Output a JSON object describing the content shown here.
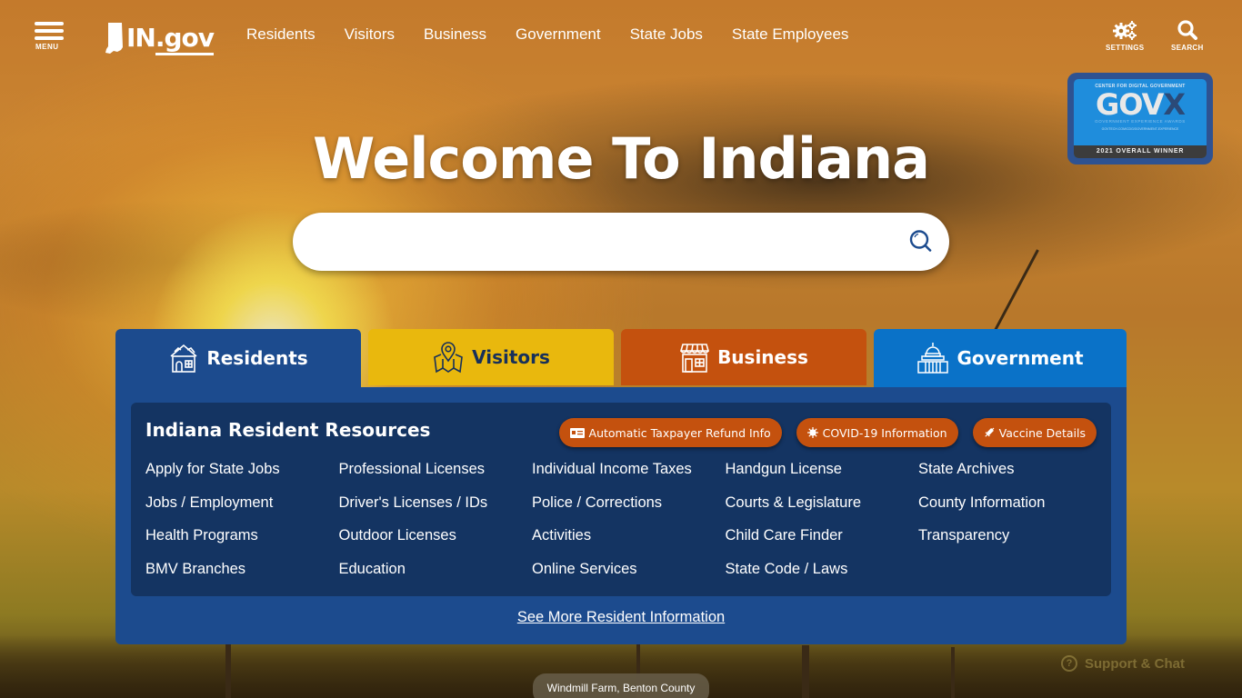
{
  "header": {
    "menu_label": "MENU",
    "logo_text": "IN",
    "logo_suffix": ".gov",
    "nav": [
      "Residents",
      "Visitors",
      "Business",
      "Government",
      "State Jobs",
      "State Employees"
    ],
    "settings_label": "SETTINGS",
    "search_label": "SEARCH"
  },
  "award": {
    "org": "CENTER FOR DIGITAL GOVERNMENT",
    "brand_main": "GOV",
    "brand_x": "X",
    "program": "GOVERNMENT EXPERIENCE AWARDS",
    "url": "GOVTECH.COM/CDG/GOVERNMENT-EXPERIENCE",
    "winner": "2021 OVERALL WINNER"
  },
  "hero": {
    "title": "Welcome To Indiana",
    "search_value": "",
    "search_placeholder": ""
  },
  "tabs": [
    {
      "label": "Residents",
      "icon": "house-icon",
      "color": "#1c4b8e",
      "active": true
    },
    {
      "label": "Visitors",
      "icon": "map-pin-icon",
      "color": "#e9b80d",
      "active": false
    },
    {
      "label": "Business",
      "icon": "storefront-icon",
      "color": "#c4510e",
      "active": false
    },
    {
      "label": "Government",
      "icon": "capitol-icon",
      "color": "#0a72c8",
      "active": false
    }
  ],
  "panel": {
    "heading": "Indiana Resident Resources",
    "pills": [
      {
        "label": "Automatic Taxpayer Refund Info",
        "icon": "id-card-icon"
      },
      {
        "label": "COVID-19 Information",
        "icon": "virus-icon"
      },
      {
        "label": "Vaccine Details",
        "icon": "syringe-icon"
      }
    ],
    "links": [
      [
        "Apply for State Jobs",
        "Jobs / Employment",
        "Health Programs",
        "BMV Branches"
      ],
      [
        "Professional Licenses",
        "Driver's Licenses / IDs",
        "Outdoor Licenses",
        "Education"
      ],
      [
        "Individual Income Taxes",
        "Police / Corrections",
        "Activities",
        "Online Services"
      ],
      [
        "Handgun License",
        "Courts & Legislature",
        "Child Care Finder",
        "State Code / Laws"
      ],
      [
        "State Archives",
        "County Information",
        "Transparency"
      ]
    ],
    "see_more": "See More Resident Information"
  },
  "footer": {
    "photo_caption": "Windmill Farm, Benton County",
    "support_label": "Support & Chat"
  }
}
